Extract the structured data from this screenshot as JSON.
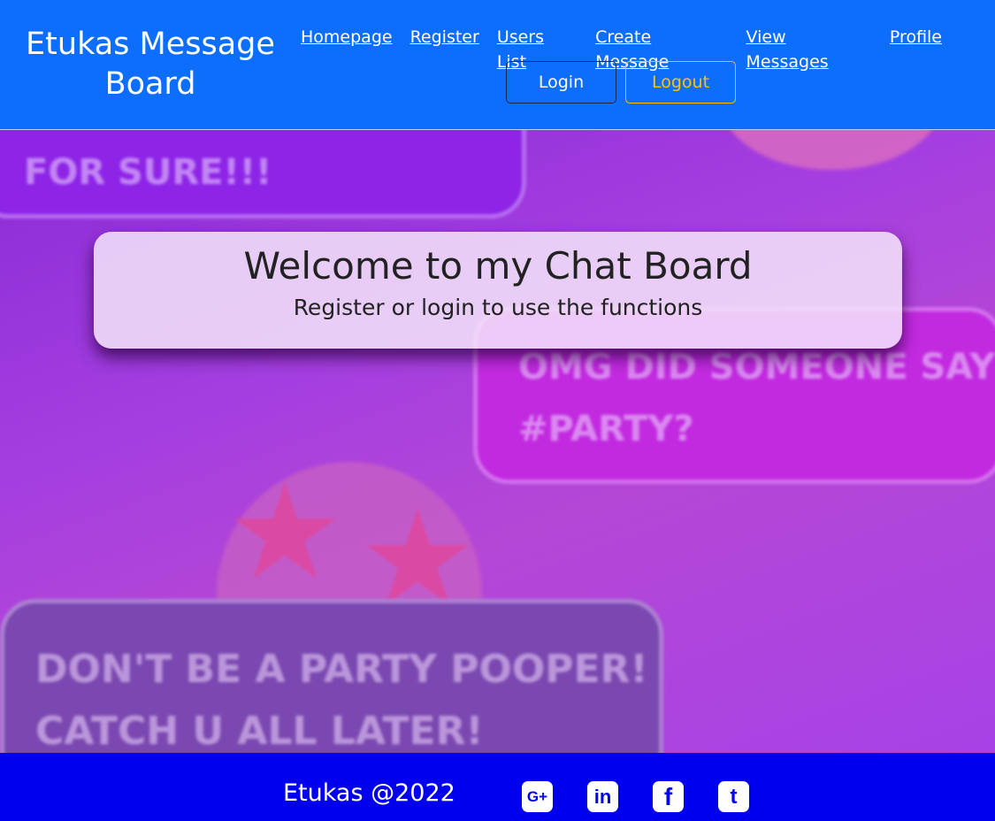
{
  "header": {
    "brand": "Etukas Message Board",
    "nav": [
      {
        "label": "Homepage"
      },
      {
        "label": "Register"
      },
      {
        "label": "Users List"
      },
      {
        "label": "Create Message"
      },
      {
        "label": "View Messages"
      },
      {
        "label": "Profile"
      }
    ],
    "login_label": "Login",
    "logout_label": "Logout"
  },
  "hero": {
    "bubbles": [
      "FOR SURE!!!",
      "OMG DID SOMEONE SAY #PARTY?",
      "DON'T BE A PARTY POOPER! CATCH U ALL LATER!"
    ],
    "title": "Welcome to my Chat Board",
    "subtitle": "Register or login to use the functions"
  },
  "footer": {
    "copyright": "Etukas @2022",
    "social": [
      {
        "icon": "google-plus-icon",
        "glyph": "G+"
      },
      {
        "icon": "linkedin-icon",
        "glyph": "in"
      },
      {
        "icon": "facebook-icon",
        "glyph": "f"
      },
      {
        "icon": "twitter-icon",
        "glyph": "t"
      }
    ]
  },
  "colors": {
    "header_bg": "#0d6efd",
    "footer_bg": "#0000ee",
    "logout_accent": "#ffc107"
  }
}
